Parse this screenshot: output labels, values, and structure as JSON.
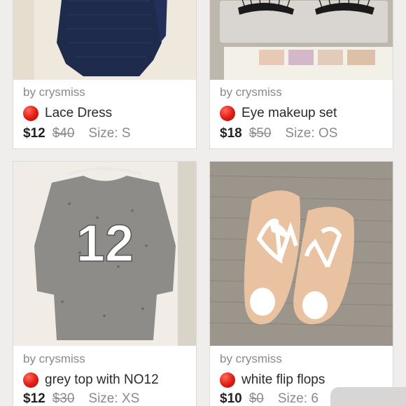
{
  "listings": [
    {
      "seller": "by crysmiss",
      "title": "Lace Dress",
      "price": "$12",
      "original_price": "$40",
      "size": "Size: S",
      "status_color": "#e01b14"
    },
    {
      "seller": "by crysmiss",
      "title": "Eye makeup set",
      "price": "$18",
      "original_price": "$50",
      "size": "Size: OS",
      "status_color": "#e01b14"
    },
    {
      "seller": "by crysmiss",
      "title": "grey top with NO12",
      "price": "$12",
      "original_price": "$30",
      "size": "Size: XS",
      "status_color": "#e01b14",
      "print_number": "12"
    },
    {
      "seller": "by crysmiss",
      "title": "white flip flops",
      "price": "$10",
      "original_price": "$0",
      "size": "Size: 6",
      "status_color": "#e01b14"
    }
  ]
}
